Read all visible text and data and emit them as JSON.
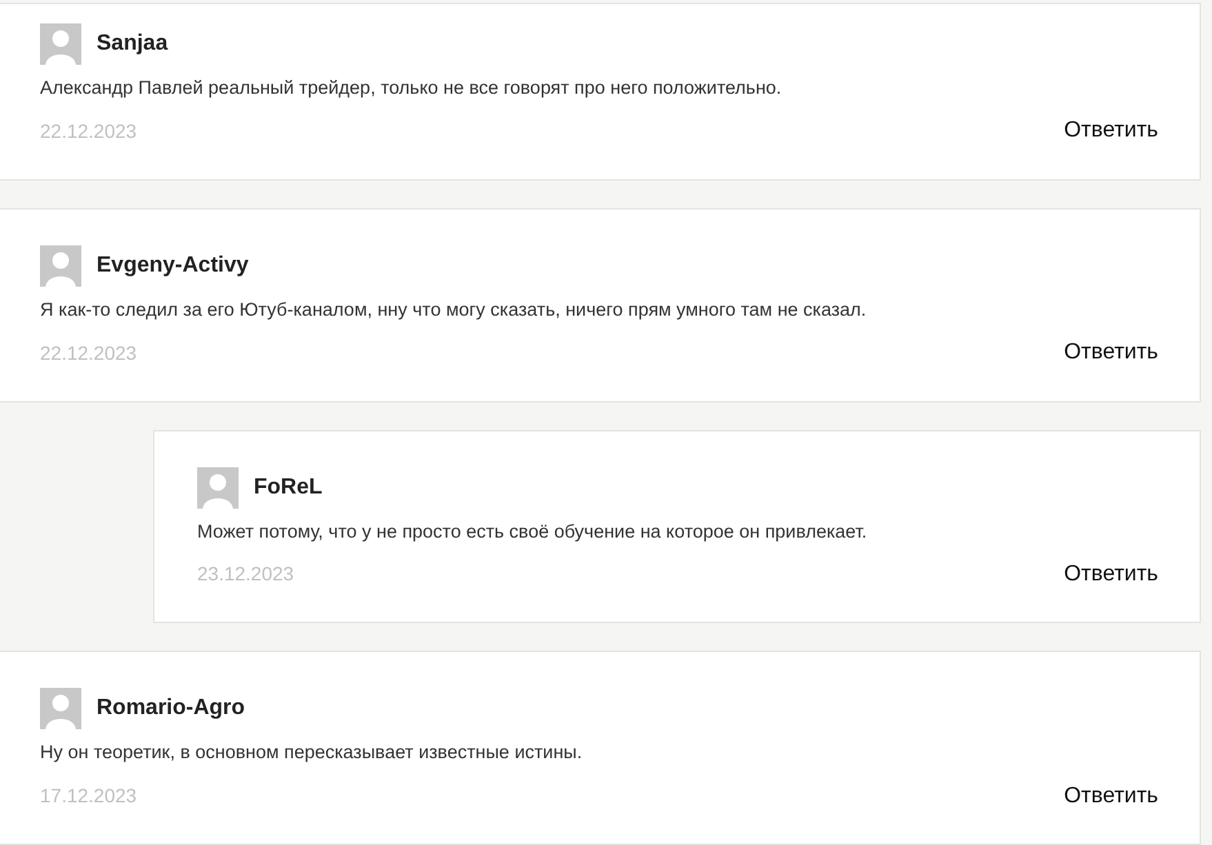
{
  "comments": [
    {
      "author": "Sanjaa",
      "text": "Александр Павлей реальный трейдер, только не все говорят про него положительно.",
      "date": "22.12.2023",
      "reply": "Ответить"
    },
    {
      "author": "Evgeny-Activy",
      "text": "Я как-то следил за его Ютуб-каналом, нну что могу сказать, ничего прям умного там не сказал.",
      "date": "22.12.2023",
      "reply": "Ответить",
      "children": [
        {
          "author": "FoReL",
          "text": "Может потому, что у не просто есть своё обучение на которое он привлекает.",
          "date": "23.12.2023",
          "reply": "Ответить"
        }
      ]
    },
    {
      "author": "Romario-Agro",
      "text": "Ну он теоретик, в основном пересказывает известные истины.",
      "date": "17.12.2023",
      "reply": "Ответить"
    }
  ]
}
